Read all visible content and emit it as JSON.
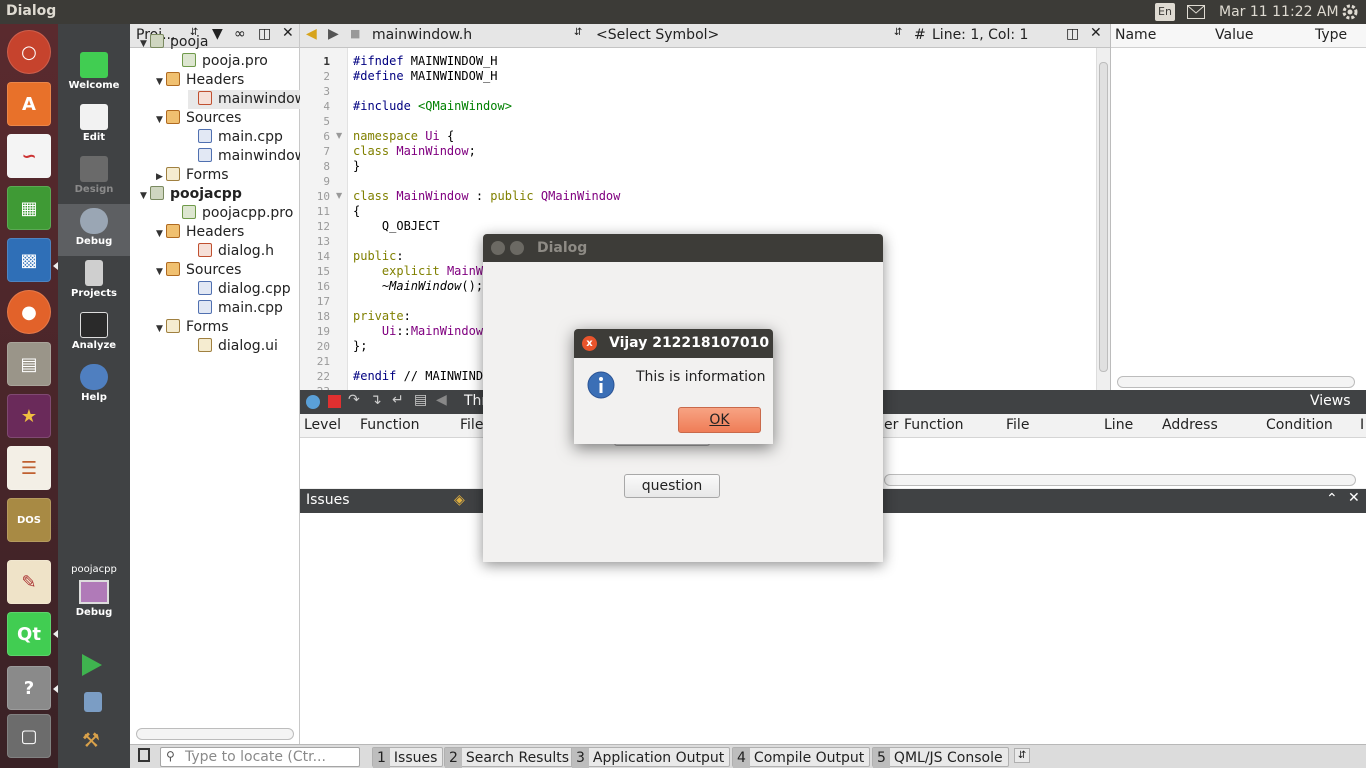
{
  "top_panel": {
    "title": "Dialog",
    "keyboard": "En",
    "clock": "Mar 11 11:22 AM"
  },
  "launcher": {
    "items": [
      "ubuntu-dash",
      "software-center",
      "libreoffice-draw",
      "libreoffice-calc",
      "libreoffice-impress",
      "firefox",
      "file-manager",
      "starred-app",
      "text-document",
      "dosbox",
      "text-editor",
      "qt-creator",
      "help",
      "save-disk"
    ]
  },
  "modes": [
    {
      "label": "Welcome"
    },
    {
      "label": "Edit"
    },
    {
      "label": "Design"
    },
    {
      "label": "Debug"
    },
    {
      "label": "Projects"
    },
    {
      "label": "Analyze"
    },
    {
      "label": "Help"
    }
  ],
  "run_target": {
    "project": "poojacpp",
    "config": "Debug"
  },
  "project_panel": {
    "selector": "Proj...",
    "tree": [
      {
        "label": "pooja",
        "icon": "project",
        "expanded": true
      },
      {
        "label": "pooja.pro",
        "icon": "pro"
      },
      {
        "label": "Headers",
        "icon": "folder-headers",
        "expanded": true
      },
      {
        "label": "mainwindow.",
        "icon": "header"
      },
      {
        "label": "Sources",
        "icon": "folder-sources",
        "expanded": true
      },
      {
        "label": "main.cpp",
        "icon": "cpp"
      },
      {
        "label": "mainwindow.",
        "icon": "cpp"
      },
      {
        "label": "Forms",
        "icon": "folder-forms",
        "expanded": false
      },
      {
        "label": "poojacpp",
        "icon": "project",
        "expanded": true
      },
      {
        "label": "poojacpp.pro",
        "icon": "pro"
      },
      {
        "label": "Headers",
        "icon": "folder-headers",
        "expanded": true
      },
      {
        "label": "dialog.h",
        "icon": "header"
      },
      {
        "label": "Sources",
        "icon": "folder-sources",
        "expanded": true
      },
      {
        "label": "dialog.cpp",
        "icon": "cpp"
      },
      {
        "label": "main.cpp",
        "icon": "cpp"
      },
      {
        "label": "Forms",
        "icon": "folder-forms",
        "expanded": true
      },
      {
        "label": "dialog.ui",
        "icon": "ui"
      }
    ]
  },
  "editor": {
    "file": "mainwindow.h",
    "symbol": "<Select Symbol>",
    "hash": "#",
    "position": "Line: 1, Col: 1",
    "lines": [
      {
        "n": "1",
        "segments": [
          {
            "t": "#ifndef",
            "c": "kw-pp"
          },
          {
            "t": " MAINWINDOW_H"
          }
        ]
      },
      {
        "n": "2",
        "segments": [
          {
            "t": "#define",
            "c": "kw-pp"
          },
          {
            "t": " MAINWINDOW_H"
          }
        ]
      },
      {
        "n": "3",
        "segments": []
      },
      {
        "n": "4",
        "segments": [
          {
            "t": "#include",
            "c": "kw-pp"
          },
          {
            "t": " "
          },
          {
            "t": "<QMainWindow>",
            "c": "kw-inc"
          }
        ]
      },
      {
        "n": "5",
        "segments": []
      },
      {
        "n": "6",
        "fold": true,
        "segments": [
          {
            "t": "namespace",
            "c": "kw"
          },
          {
            "t": " "
          },
          {
            "t": "Ui",
            "c": "tp"
          },
          {
            "t": " {"
          }
        ]
      },
      {
        "n": "7",
        "segments": [
          {
            "t": "class",
            "c": "kw"
          },
          {
            "t": " "
          },
          {
            "t": "MainWindow",
            "c": "tp"
          },
          {
            "t": ";"
          }
        ]
      },
      {
        "n": "8",
        "segments": [
          {
            "t": "}"
          }
        ]
      },
      {
        "n": "9",
        "segments": []
      },
      {
        "n": "10",
        "fold": true,
        "segments": [
          {
            "t": "class",
            "c": "kw"
          },
          {
            "t": " "
          },
          {
            "t": "MainWindow",
            "c": "tp"
          },
          {
            "t": " : "
          },
          {
            "t": "public",
            "c": "kw"
          },
          {
            "t": " "
          },
          {
            "t": "QMainWindow",
            "c": "tp"
          }
        ]
      },
      {
        "n": "11",
        "segments": [
          {
            "t": "{"
          }
        ]
      },
      {
        "n": "12",
        "segments": [
          {
            "t": "    Q_OBJECT"
          }
        ]
      },
      {
        "n": "13",
        "segments": []
      },
      {
        "n": "14",
        "segments": [
          {
            "t": "public",
            "c": "kw"
          },
          {
            "t": ":"
          }
        ]
      },
      {
        "n": "15",
        "segments": [
          {
            "t": "    "
          },
          {
            "t": "explicit",
            "c": "kw"
          },
          {
            "t": " "
          },
          {
            "t": "MainW",
            "c": "tp"
          }
        ]
      },
      {
        "n": "16",
        "segments": [
          {
            "t": "    ~"
          },
          {
            "t": "MainWindow",
            "c": "it"
          },
          {
            "t": "();"
          }
        ]
      },
      {
        "n": "17",
        "segments": []
      },
      {
        "n": "18",
        "segments": [
          {
            "t": "private",
            "c": "kw"
          },
          {
            "t": ":"
          }
        ]
      },
      {
        "n": "19",
        "segments": [
          {
            "t": "    "
          },
          {
            "t": "Ui",
            "c": "tp"
          },
          {
            "t": "::"
          },
          {
            "t": "MainWindow",
            "c": "tp"
          }
        ]
      },
      {
        "n": "20",
        "segments": [
          {
            "t": "};"
          }
        ]
      },
      {
        "n": "21",
        "segments": []
      },
      {
        "n": "22",
        "segments": [
          {
            "t": "#endif",
            "c": "kw-pp"
          },
          {
            "t": " // MAINWIND"
          }
        ]
      },
      {
        "n": "23",
        "segments": []
      }
    ]
  },
  "locals": {
    "columns": [
      "Name",
      "Value",
      "Type"
    ]
  },
  "debugger": {
    "threads_label": "Thr",
    "views_label": "Views",
    "stack_columns_left": [
      "Level",
      "Function",
      "File"
    ],
    "stack_columns_right": [
      "er",
      "Function",
      "File",
      "Line",
      "Address",
      "Condition",
      "I"
    ]
  },
  "issues": {
    "title": "Issues"
  },
  "statusbar": {
    "locate_placeholder": "Type to locate (Ctr...",
    "tabs": [
      {
        "num": "1",
        "label": "Issues"
      },
      {
        "num": "2",
        "label": "Search Results"
      },
      {
        "num": "3",
        "label": "Application Output"
      },
      {
        "num": "4",
        "label": "Compile Output"
      },
      {
        "num": "5",
        "label": "QML/JS Console"
      }
    ]
  },
  "dialog": {
    "title": "Dialog",
    "question_button": "question"
  },
  "message_box": {
    "title": "Vijay 212218107010",
    "text": "This is information",
    "ok": "OK",
    "close": "x"
  },
  "colors": {
    "accent": "#ef7d57",
    "panel_dark": "#404244",
    "launcher": "#4a2428"
  }
}
